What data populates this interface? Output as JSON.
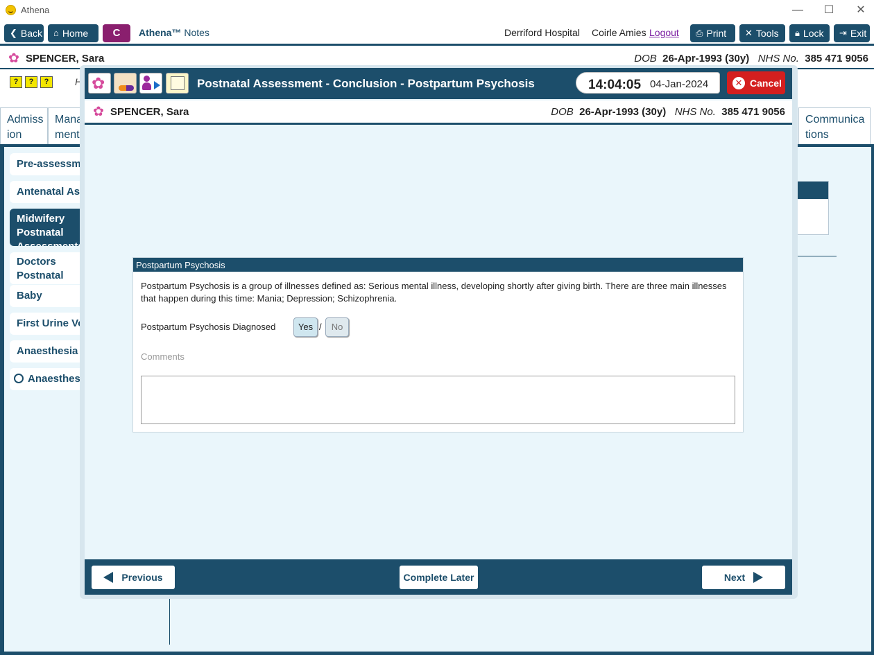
{
  "window": {
    "title": "Athena",
    "minimize": "—",
    "maximize": "☐",
    "close": "✕"
  },
  "toolbar": {
    "back": "Back",
    "home": "Home",
    "c_label": "C",
    "brand": "Athena™",
    "brand_sub": "Notes",
    "hospital": "Derriford Hospital",
    "user": "Coirle Amies",
    "logout": "Logout",
    "print": "Print",
    "tools": "Tools",
    "lock": "Lock",
    "exit": "Exit"
  },
  "patient": {
    "name": "SPENCER, Sara",
    "dob_label": "DOB",
    "dob": "26-Apr-1993 (30y)",
    "nhs_label": "NHS No.",
    "nhs": "385 471 9056"
  },
  "background": {
    "tabs": [
      "Admiss ion",
      "Mana ment",
      "Communica tions"
    ],
    "nav": [
      {
        "label": "Pre-assessment"
      },
      {
        "label": "Antenatal Assessments"
      },
      {
        "label": "Midwifery Postnatal Assessments"
      },
      {
        "label": "Doctors Postnatal Assessments"
      },
      {
        "label": "Baby"
      },
      {
        "label": "First Urine Void"
      },
      {
        "label": "Anaesthesia Information"
      },
      {
        "label": "Anaesthesia"
      }
    ],
    "hidden_letter": "H"
  },
  "modal": {
    "title": "Postnatal Assessment - Conclusion - Postpartum Psychosis",
    "time": "14:04:05",
    "date": "04-Jan-2024",
    "cancel": "Cancel",
    "section": {
      "header": "Postpartum Psychosis",
      "description": "Postpartum Psychosis is a group of illnesses defined as: Serious mental illness, developing shortly after giving birth. There are three main illnesses that happen during this time: Mania; Depression; Schizophrenia.",
      "question": "Postpartum Psychosis Diagnosed",
      "yes": "Yes",
      "no": "No",
      "separator": "/",
      "comments_label": "Comments",
      "comments_value": ""
    },
    "footer": {
      "previous": "Previous",
      "complete_later": "Complete Later",
      "next": "Next"
    }
  },
  "colors": {
    "primary": "#1c4e6b",
    "accent": "#8a1f6e",
    "cancel": "#d41f1f",
    "panel": "#eaf6fb"
  }
}
